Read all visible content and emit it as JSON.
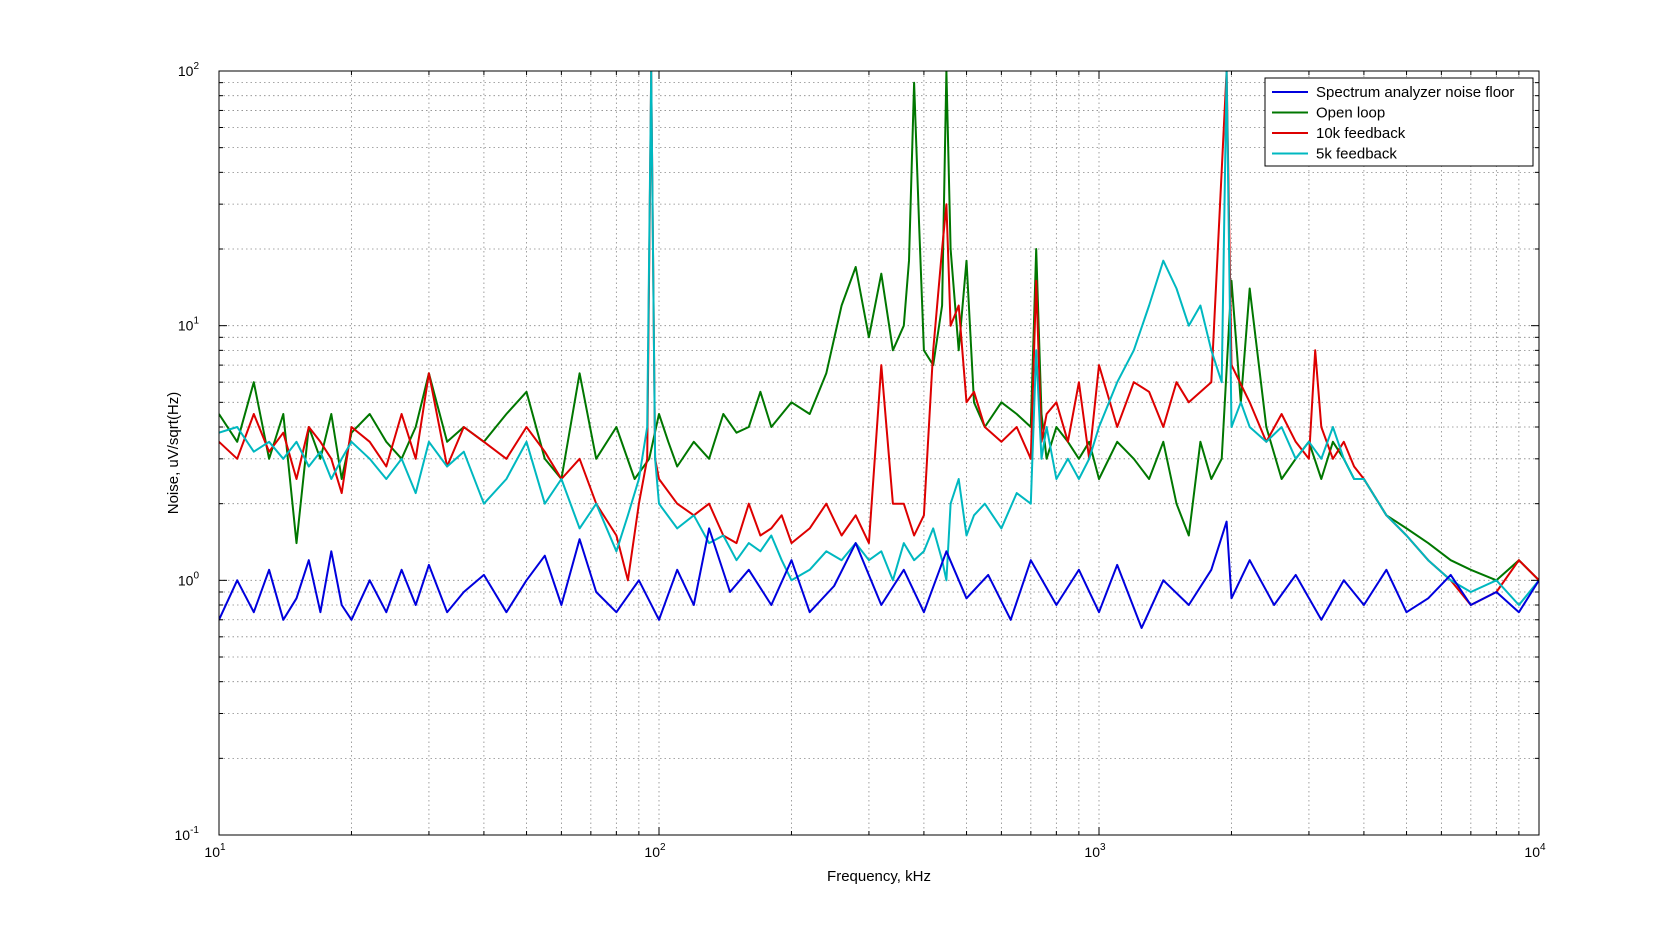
{
  "chart_data": {
    "type": "line",
    "title": "",
    "xlabel": "Frequency, kHz",
    "ylabel": "Noise, uV/sqrt(Hz)",
    "xscale": "log",
    "yscale": "log",
    "xlim": [
      10,
      10000
    ],
    "ylim": [
      0.1,
      100
    ],
    "grid": true,
    "legend_position": "top-right",
    "x_ticks": [
      {
        "base": "10",
        "exp": "1"
      },
      {
        "base": "10",
        "exp": "2"
      },
      {
        "base": "10",
        "exp": "3"
      },
      {
        "base": "10",
        "exp": "4"
      }
    ],
    "y_ticks": [
      {
        "base": "10",
        "exp": "-1"
      },
      {
        "base": "10",
        "exp": "0"
      },
      {
        "base": "10",
        "exp": "1"
      },
      {
        "base": "10",
        "exp": "2"
      }
    ],
    "series": [
      {
        "name": "Spectrum analyzer noise floor",
        "color": "#0000dd",
        "x": [
          10,
          11,
          12,
          13,
          14,
          15,
          16,
          17,
          18,
          19,
          20,
          22,
          24,
          26,
          28,
          30,
          33,
          36,
          40,
          45,
          50,
          55,
          60,
          66,
          72,
          80,
          90,
          100,
          110,
          120,
          130,
          145,
          160,
          180,
          200,
          220,
          250,
          280,
          320,
          360,
          400,
          450,
          500,
          560,
          630,
          700,
          800,
          900,
          1000,
          1100,
          1250,
          1400,
          1600,
          1800,
          1950,
          2000,
          2200,
          2500,
          2800,
          3200,
          3600,
          4000,
          4500,
          5000,
          5600,
          6300,
          7000,
          8000,
          9000,
          10000
        ],
        "y": [
          0.7,
          1.0,
          0.75,
          1.1,
          0.7,
          0.85,
          1.2,
          0.75,
          1.3,
          0.8,
          0.7,
          1.0,
          0.75,
          1.1,
          0.8,
          1.15,
          0.75,
          0.9,
          1.05,
          0.75,
          1.0,
          1.25,
          0.8,
          1.45,
          0.9,
          0.75,
          1.0,
          0.7,
          1.1,
          0.8,
          1.6,
          0.9,
          1.1,
          0.8,
          1.2,
          0.75,
          0.95,
          1.4,
          0.8,
          1.1,
          0.75,
          1.3,
          0.85,
          1.05,
          0.7,
          1.2,
          0.8,
          1.1,
          0.75,
          1.15,
          0.65,
          1.0,
          0.8,
          1.1,
          1.7,
          0.85,
          1.2,
          0.8,
          1.05,
          0.7,
          1.0,
          0.8,
          1.1,
          0.75,
          0.85,
          1.05,
          0.8,
          0.9,
          0.75,
          1.0
        ]
      },
      {
        "name": "Open loop",
        "color": "#007700",
        "x": [
          10,
          11,
          12,
          13,
          14,
          15,
          16,
          17,
          18,
          19,
          20,
          22,
          24,
          26,
          28,
          30,
          33,
          36,
          40,
          45,
          50,
          55,
          60,
          66,
          72,
          80,
          88,
          95,
          100,
          105,
          110,
          120,
          130,
          140,
          150,
          160,
          170,
          180,
          200,
          220,
          240,
          260,
          280,
          300,
          320,
          340,
          360,
          370,
          380,
          390,
          400,
          420,
          440,
          450,
          460,
          480,
          500,
          520,
          550,
          600,
          650,
          700,
          720,
          740,
          760,
          800,
          850,
          900,
          950,
          1000,
          1100,
          1200,
          1300,
          1400,
          1500,
          1600,
          1700,
          1800,
          1900,
          2000,
          2100,
          2200,
          2400,
          2600,
          2800,
          3000,
          3200,
          3400,
          3600,
          3800,
          4000,
          4500,
          5000,
          5600,
          6300,
          7000,
          8000,
          9000,
          10000
        ],
        "y": [
          4.5,
          3.5,
          6.0,
          3.0,
          4.5,
          1.4,
          4.0,
          3.0,
          4.5,
          2.5,
          3.8,
          4.5,
          3.5,
          3.0,
          4.0,
          6.5,
          3.5,
          4.0,
          3.5,
          4.5,
          5.5,
          3.0,
          2.5,
          6.5,
          3.0,
          4.0,
          2.5,
          3.0,
          4.5,
          3.5,
          2.8,
          3.5,
          3.0,
          4.5,
          3.8,
          4.0,
          5.5,
          4.0,
          5.0,
          4.5,
          6.5,
          12.0,
          17.0,
          9.0,
          16.0,
          8.0,
          10.0,
          18.0,
          90.0,
          25.0,
          8.0,
          7.0,
          12.0,
          100.0,
          20.0,
          8.0,
          18.0,
          5.0,
          4.0,
          5.0,
          4.5,
          4.0,
          20.0,
          4.5,
          3.0,
          4.0,
          3.5,
          3.0,
          3.5,
          2.5,
          3.5,
          3.0,
          2.5,
          3.5,
          2.0,
          1.5,
          3.5,
          2.5,
          3.0,
          15.0,
          5.0,
          14.0,
          4.0,
          2.5,
          3.0,
          3.5,
          2.5,
          3.5,
          3.0,
          2.5,
          2.5,
          1.8,
          1.6,
          1.4,
          1.2,
          1.1,
          1.0,
          1.2,
          1.0
        ]
      },
      {
        "name": "10k feedback",
        "color": "#dd0000",
        "x": [
          10,
          11,
          12,
          13,
          14,
          15,
          16,
          17,
          18,
          19,
          20,
          22,
          24,
          26,
          28,
          30,
          33,
          36,
          40,
          45,
          50,
          55,
          60,
          66,
          72,
          80,
          85,
          90,
          94,
          96,
          98,
          100,
          110,
          120,
          130,
          140,
          150,
          160,
          170,
          180,
          190,
          200,
          220,
          240,
          260,
          280,
          300,
          320,
          340,
          360,
          380,
          400,
          420,
          440,
          450,
          460,
          480,
          500,
          520,
          550,
          600,
          650,
          700,
          720,
          740,
          760,
          800,
          850,
          900,
          950,
          1000,
          1100,
          1200,
          1300,
          1400,
          1500,
          1600,
          1800,
          1950,
          2000,
          2200,
          2400,
          2600,
          2800,
          3000,
          3100,
          3200,
          3400,
          3600,
          3800,
          4000,
          4500,
          5000,
          5600,
          6300,
          7000,
          8000,
          9000,
          10000
        ],
        "y": [
          3.5,
          3.0,
          4.5,
          3.2,
          3.8,
          2.5,
          4.0,
          3.5,
          3.0,
          2.2,
          4.0,
          3.5,
          2.8,
          4.5,
          3.0,
          6.5,
          2.8,
          4.0,
          3.5,
          3.0,
          4.0,
          3.2,
          2.5,
          3.0,
          2.0,
          1.5,
          1.0,
          2.0,
          3.0,
          100.0,
          3.0,
          2.5,
          2.0,
          1.8,
          2.0,
          1.5,
          1.4,
          2.0,
          1.5,
          1.6,
          1.8,
          1.4,
          1.6,
          2.0,
          1.5,
          1.8,
          1.4,
          7.0,
          2.0,
          2.0,
          1.5,
          1.8,
          8.0,
          20.0,
          30.0,
          10.0,
          12.0,
          5.0,
          5.5,
          4.0,
          3.5,
          4.0,
          3.0,
          15.0,
          3.5,
          4.5,
          5.0,
          3.5,
          6.0,
          3.0,
          7.0,
          4.0,
          6.0,
          5.5,
          4.0,
          6.0,
          5.0,
          6.0,
          100.0,
          7.0,
          5.0,
          3.5,
          4.5,
          3.5,
          3.0,
          8.0,
          4.0,
          3.0,
          3.5,
          2.8,
          2.5,
          1.8,
          1.5,
          1.2,
          1.0,
          0.8,
          0.9,
          1.2,
          1.0
        ]
      },
      {
        "name": "5k feedback",
        "color": "#00b8c0",
        "x": [
          10,
          11,
          12,
          13,
          14,
          15,
          16,
          17,
          18,
          19,
          20,
          22,
          24,
          26,
          28,
          30,
          33,
          36,
          40,
          45,
          50,
          55,
          60,
          66,
          72,
          80,
          85,
          90,
          94,
          96,
          98,
          100,
          110,
          120,
          130,
          140,
          150,
          160,
          170,
          180,
          190,
          200,
          220,
          240,
          260,
          280,
          300,
          320,
          340,
          360,
          380,
          400,
          420,
          440,
          450,
          460,
          480,
          500,
          520,
          550,
          600,
          650,
          700,
          720,
          740,
          760,
          800,
          850,
          900,
          950,
          1000,
          1100,
          1200,
          1300,
          1400,
          1500,
          1600,
          1700,
          1800,
          1900,
          1950,
          2000,
          2100,
          2200,
          2400,
          2600,
          2800,
          3000,
          3200,
          3400,
          3600,
          3800,
          4000,
          4500,
          5000,
          5600,
          6300,
          7000,
          8000,
          9000,
          10000
        ],
        "y": [
          3.8,
          4.0,
          3.2,
          3.5,
          3.0,
          3.5,
          2.8,
          3.2,
          2.5,
          3.0,
          3.5,
          3.0,
          2.5,
          3.0,
          2.2,
          3.5,
          2.8,
          3.2,
          2.0,
          2.5,
          3.5,
          2.0,
          2.5,
          1.6,
          2.0,
          1.3,
          1.8,
          2.5,
          4.0,
          100.0,
          3.0,
          2.0,
          1.6,
          1.8,
          1.4,
          1.5,
          1.2,
          1.4,
          1.3,
          1.5,
          1.2,
          1.0,
          1.1,
          1.3,
          1.2,
          1.4,
          1.2,
          1.3,
          1.0,
          1.4,
          1.2,
          1.3,
          1.6,
          1.2,
          1.0,
          2.0,
          2.5,
          1.5,
          1.8,
          2.0,
          1.6,
          2.2,
          2.0,
          8.0,
          3.0,
          4.0,
          2.5,
          3.0,
          2.5,
          3.0,
          4.0,
          6.0,
          8.0,
          12.0,
          18.0,
          14.0,
          10.0,
          12.0,
          8.0,
          6.0,
          100.0,
          4.0,
          5.0,
          4.0,
          3.5,
          4.0,
          3.0,
          3.5,
          3.0,
          4.0,
          3.0,
          2.5,
          2.5,
          1.8,
          1.5,
          1.2,
          1.0,
          0.9,
          1.0,
          0.8,
          1.0
        ]
      }
    ]
  }
}
